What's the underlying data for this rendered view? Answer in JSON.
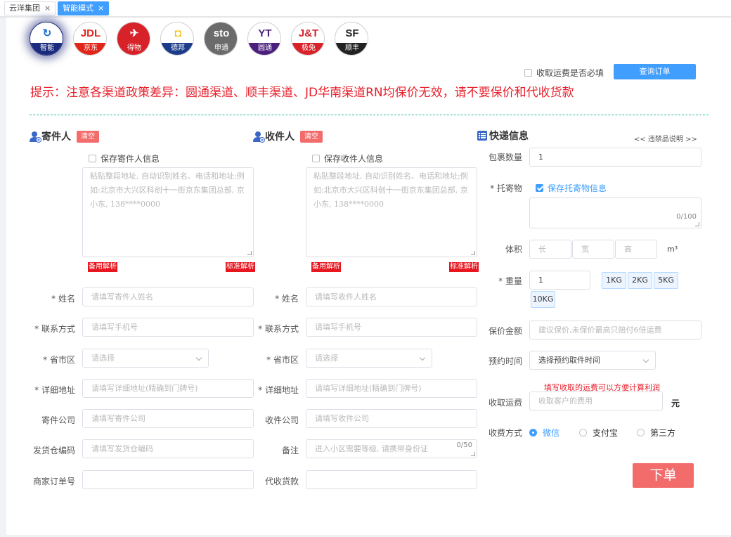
{
  "tabs": [
    {
      "label": "云洋集团",
      "close": "×"
    },
    {
      "label": "智能模式",
      "close": "×"
    }
  ],
  "carriers": [
    {
      "id": "smart",
      "logo": "↻",
      "name": "智能",
      "band_color": "#1a2a7c",
      "logo_color": "#1a6fd1",
      "selected": true
    },
    {
      "id": "jdl",
      "logo": "JDL",
      "name": "京东",
      "band_color": "#e1251b",
      "logo_color": "#e1251b"
    },
    {
      "id": "debang",
      "logo": "✈",
      "name": "得物",
      "band_color": "#d7222a",
      "logo_color": "#ffffff"
    },
    {
      "id": "deppon",
      "logo": "◘",
      "name": "德邦",
      "band_color": "#1b3b8b",
      "logo_color": "#f5c200"
    },
    {
      "id": "sto",
      "logo": "sto",
      "name": "申通",
      "band_color": "#6b6b6b",
      "logo_color": "#ffffff"
    },
    {
      "id": "yto",
      "logo": "YT",
      "name": "圆通",
      "band_color": "#4b1f7d",
      "logo_color": "#4b1f7d"
    },
    {
      "id": "jt",
      "logo": "J&T",
      "name": "极兔",
      "band_color": "#d7222a",
      "logo_color": "#d7222a"
    },
    {
      "id": "sf",
      "logo": "SF",
      "name": "顺丰",
      "band_color": "#222222",
      "logo_color": "#222222"
    }
  ],
  "top": {
    "freight_required_label": "收取运费是否必填",
    "query_button": "查询订单",
    "hint": "提示：注意各渠道政策差异：圆通渠道、顺丰渠道、JD华南渠道RN均保价无效，请不要保价和代收货款"
  },
  "sender": {
    "title": "寄件人",
    "clear": "清空",
    "save_label": "保存寄件人信息",
    "paste_placeholder": "粘贴整段地址, 自动识别姓名、电话和地址;例如:北京市大兴区科创十一街京东集团总部, 京小东, 138****0000",
    "backup_parse": "备用解析",
    "standard_parse": "标准解析",
    "fields": [
      {
        "label": "* 姓名",
        "placeholder": "请填写寄件人姓名"
      },
      {
        "label": "* 联系方式",
        "placeholder": "请填写手机号"
      },
      {
        "label": "* 省市区",
        "placeholder": "请选择"
      },
      {
        "label": "* 详细地址",
        "placeholder": "请填写详细地址(精确到门牌号)"
      },
      {
        "label": "寄件公司",
        "placeholder": "请填写寄件公司"
      },
      {
        "label": "发货仓编码",
        "placeholder": "请填写发货仓编码"
      },
      {
        "label": "商家订单号",
        "placeholder": ""
      }
    ]
  },
  "receiver": {
    "title": "收件人",
    "clear": "清空",
    "save_label": "保存收件人信息",
    "paste_placeholder": "粘贴整段地址, 自动识别姓名、电话和地址;例如:北京市大兴区科创十一街京东集团总部, 京小东, 138****0000",
    "backup_parse": "备用解析",
    "standard_parse": "标准解析",
    "fields": [
      {
        "label": "* 姓名",
        "placeholder": "请填写收件人姓名"
      },
      {
        "label": "* 联系方式",
        "placeholder": "请填写手机号"
      },
      {
        "label": "* 省市区",
        "placeholder": "请选择"
      },
      {
        "label": "* 详细地址",
        "placeholder": "请填写详细地址(精确到门牌号)"
      },
      {
        "label": "收件公司",
        "placeholder": "请填写收件公司"
      },
      {
        "label": "备注",
        "placeholder": "进入小区需要等级, 请携带身份证",
        "counter": "0/50"
      },
      {
        "label": "代收货款",
        "placeholder": ""
      }
    ]
  },
  "express": {
    "title": "快递信息",
    "prohibited_link": "<< 违禁品说明 >>",
    "package_count_label": "包裹数量",
    "package_count_value": "1",
    "item_label": "* 托寄物",
    "save_item_label": "保存托寄物信息",
    "item_counter": "0/100",
    "volume_label": "体积",
    "volume_placeholders": [
      "长",
      "宽",
      "高"
    ],
    "volume_unit": "m³",
    "weight_label": "* 重量",
    "weight_value": "1",
    "weight_presets": [
      "1KG",
      "2KG",
      "5KG",
      "10KG"
    ],
    "insured_label": "保价金额",
    "insured_placeholder": "建议保价,未保价最高只赔付6倍运费",
    "pickup_label": "预约时间",
    "pickup_value": "选择预约取件时间",
    "freight_tip": "填写收取的运费可以方便计算利润",
    "freight_label": "收取运费",
    "freight_placeholder": "收取客户的费用",
    "freight_unit": "元",
    "payment_label": "收费方式",
    "payment_options": [
      {
        "label": "微信",
        "selected": true
      },
      {
        "label": "支付宝",
        "selected": false
      },
      {
        "label": "第三方",
        "selected": false
      }
    ],
    "submit": "下单"
  }
}
